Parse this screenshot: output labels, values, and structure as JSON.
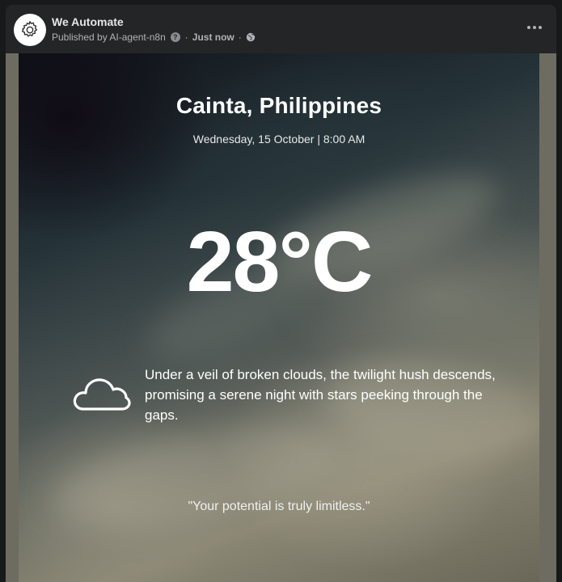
{
  "post": {
    "page_name": "We Automate",
    "published_by": "Published by AI-agent-n8n",
    "help_glyph": "?",
    "separator": "·",
    "time": "Just now",
    "privacy_icon": "globe-icon",
    "more_icon": "more-horizontal-icon",
    "avatar_icon": "gear-icon"
  },
  "weather_card": {
    "city": "Cainta, Philippines",
    "datetime": "Wednesday, 15 October | 8:00 AM",
    "temperature": "28°C",
    "condition_icon": "cloud-icon",
    "description": "Under a veil of broken clouds, the twilight hush descends, promising a serene night with stars peeking through the gaps.",
    "quote": "\"Your potential is truly limitless.\""
  },
  "colors": {
    "background": "#18191a",
    "card": "#242526",
    "primary_text": "#e4e6eb",
    "secondary_text": "#b0b3b8"
  }
}
